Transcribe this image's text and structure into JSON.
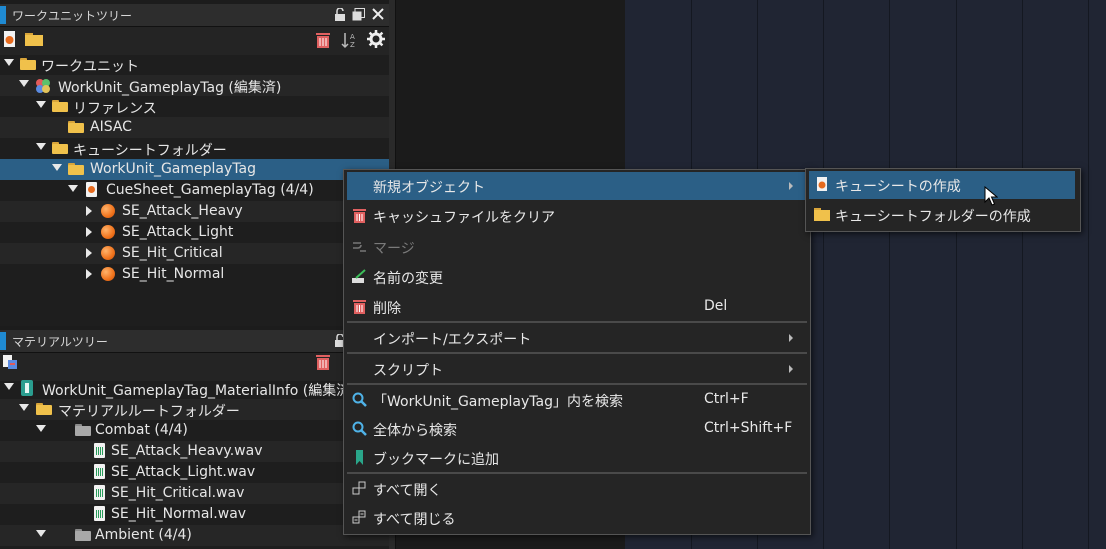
{
  "work_unit_panel": {
    "title": "ワークユニットツリー",
    "tree": [
      {
        "label": "ワークユニット"
      },
      {
        "label": "WorkUnit_GameplayTag (編集済)"
      },
      {
        "label": "リファレンス"
      },
      {
        "label": "AISAC"
      },
      {
        "label": "キューシートフォルダー"
      },
      {
        "label": "WorkUnit_GameplayTag"
      },
      {
        "label": "CueSheet_GameplayTag (4/4)"
      },
      {
        "label": "SE_Attack_Heavy"
      },
      {
        "label": "SE_Attack_Light"
      },
      {
        "label": "SE_Hit_Critical"
      },
      {
        "label": "SE_Hit_Normal"
      }
    ]
  },
  "material_panel": {
    "title": "マテリアルツリー",
    "tree": [
      {
        "label": "WorkUnit_GameplayTag_MaterialInfo (編集済)"
      },
      {
        "label": "マテリアルルートフォルダー"
      },
      {
        "label": "Combat (4/4)"
      },
      {
        "label": "SE_Attack_Heavy.wav"
      },
      {
        "label": "SE_Attack_Light.wav"
      },
      {
        "label": "SE_Hit_Critical.wav"
      },
      {
        "label": "SE_Hit_Normal.wav"
      },
      {
        "label": "Ambient (4/4)"
      }
    ]
  },
  "context_menu": {
    "items": [
      {
        "label": "新規オブジェクト",
        "shortcut": ""
      },
      {
        "label": "キャッシュファイルをクリア",
        "shortcut": ""
      },
      {
        "label": "マージ",
        "shortcut": ""
      },
      {
        "label": "名前の変更",
        "shortcut": ""
      },
      {
        "label": "削除",
        "shortcut": "Del"
      },
      {
        "label": "インポート/エクスポート",
        "shortcut": ""
      },
      {
        "label": "スクリプト",
        "shortcut": ""
      },
      {
        "label": "「WorkUnit_GameplayTag」内を検索",
        "shortcut": "Ctrl+F"
      },
      {
        "label": "全体から検索",
        "shortcut": "Ctrl+Shift+F"
      },
      {
        "label": "ブックマークに追加",
        "shortcut": ""
      },
      {
        "label": "すべて開く",
        "shortcut": ""
      },
      {
        "label": "すべて閉じる",
        "shortcut": ""
      }
    ]
  },
  "submenu": {
    "items": [
      {
        "label": "キューシートの作成"
      },
      {
        "label": "キューシートフォルダーの作成"
      }
    ]
  },
  "colors": {
    "selection": "#2b5f86",
    "accent": "#1f8ad2",
    "folder": "#f0c14b",
    "cue_orb": "#f0731c"
  }
}
